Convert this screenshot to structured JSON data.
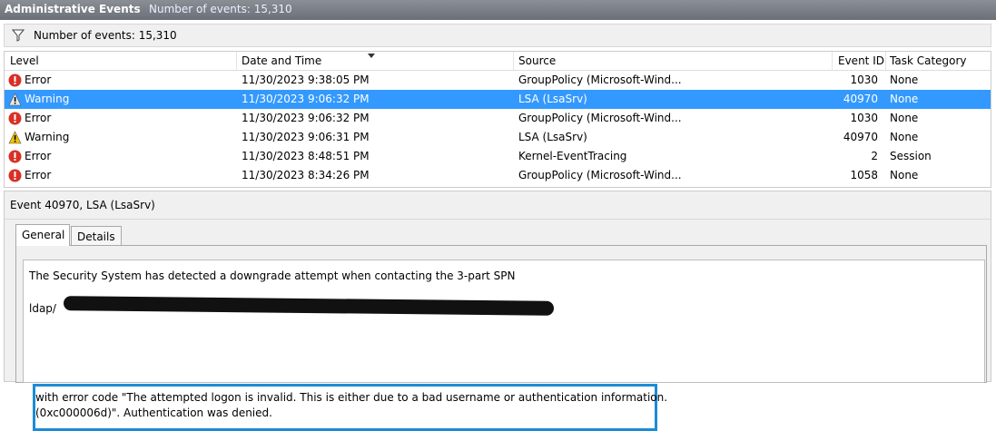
{
  "titlebar": {
    "title": "Administrative Events",
    "subtitle": "Number of events: 15,310"
  },
  "filterbar": {
    "icon": "filter-icon",
    "text": "Number of events: 15,310"
  },
  "grid": {
    "columns": [
      "Level",
      "Date and Time",
      "Source",
      "Event ID",
      "Task Category"
    ],
    "sort_column": "Date and Time",
    "rows": [
      {
        "level": "Error",
        "icon": "error-icon",
        "datetime": "11/30/2023 9:38:05 PM",
        "source": "GroupPolicy (Microsoft-Wind...",
        "event_id": "1030",
        "task": "None",
        "selected": false
      },
      {
        "level": "Warning",
        "icon": "warning-icon",
        "datetime": "11/30/2023 9:06:32 PM",
        "source": "LSA (LsaSrv)",
        "event_id": "40970",
        "task": "None",
        "selected": true
      },
      {
        "level": "Error",
        "icon": "error-icon",
        "datetime": "11/30/2023 9:06:32 PM",
        "source": "GroupPolicy (Microsoft-Wind...",
        "event_id": "1030",
        "task": "None",
        "selected": false
      },
      {
        "level": "Warning",
        "icon": "warning-icon",
        "datetime": "11/30/2023 9:06:31 PM",
        "source": "LSA (LsaSrv)",
        "event_id": "40970",
        "task": "None",
        "selected": false
      },
      {
        "level": "Error",
        "icon": "error-icon",
        "datetime": "11/30/2023 8:48:51 PM",
        "source": "Kernel-EventTracing",
        "event_id": "2",
        "task": "Session",
        "selected": false
      },
      {
        "level": "Error",
        "icon": "error-icon",
        "datetime": "11/30/2023 8:34:26 PM",
        "source": "GroupPolicy (Microsoft-Wind...",
        "event_id": "1058",
        "task": "None",
        "selected": false
      }
    ]
  },
  "details": {
    "title": "Event 40970, LSA (LsaSrv)",
    "tabs": [
      "General",
      "Details"
    ],
    "active_tab": "General",
    "message_line1": "The Security System has detected a downgrade attempt when contacting the 3-part SPN",
    "message_line2": "ldap/",
    "highlight_line1": "with error code \"The attempted logon is invalid. This is either due to a bad username or authentication information.",
    "highlight_line2": "(0xc000006d)\". Authentication was denied."
  },
  "colors": {
    "selection": "#3399ff",
    "highlight_border": "#1c8cd6",
    "error": "#d93025",
    "warning": "#f2c200"
  }
}
